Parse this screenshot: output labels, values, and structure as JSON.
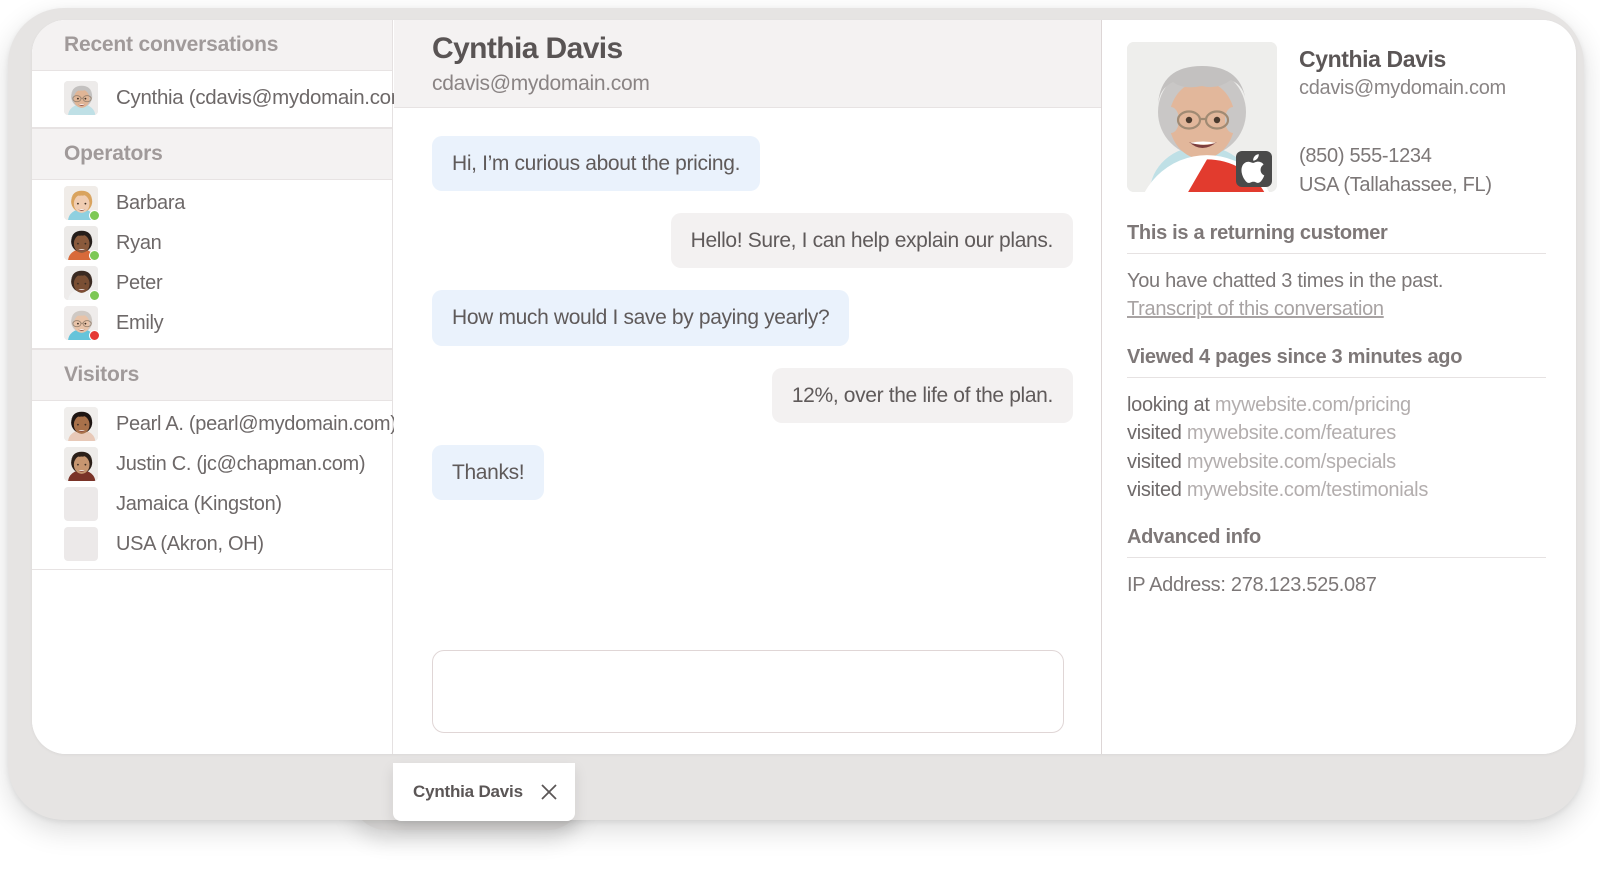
{
  "sidebar": {
    "sections": [
      {
        "title": "Recent conversations",
        "items": [
          {
            "label": "Cynthia (cdavis@mydomain.com)",
            "avatar": "cynthia",
            "status": ""
          }
        ]
      },
      {
        "title": "Operators",
        "items": [
          {
            "label": "Barbara",
            "avatar": "barbara",
            "status": "online",
            "status_color": "#7dc855"
          },
          {
            "label": "Ryan",
            "avatar": "ryan",
            "status": "online",
            "status_color": "#7dc855"
          },
          {
            "label": "Peter",
            "avatar": "peter",
            "status": "online",
            "status_color": "#7dc855"
          },
          {
            "label": "Emily",
            "avatar": "emily",
            "status": "busy",
            "status_color": "#e53935"
          }
        ]
      },
      {
        "title": "Visitors",
        "items": [
          {
            "label": "Pearl A. (pearl@mydomain.com)",
            "avatar": "pearl",
            "status": ""
          },
          {
            "label": "Justin C. (jc@chapman.com)",
            "avatar": "justin",
            "status": ""
          },
          {
            "label": "Jamaica (Kingston)",
            "avatar": "none",
            "status": ""
          },
          {
            "label": "USA (Akron, OH)",
            "avatar": "none",
            "status": ""
          }
        ]
      }
    ]
  },
  "chat": {
    "title": "Cynthia Davis",
    "subtitle": "cdavis@mydomain.com",
    "messages": [
      {
        "from": "visitor",
        "text": "Hi, I’m curious about the pricing."
      },
      {
        "from": "operator",
        "text": "Hello! Sure, I can help explain our plans."
      },
      {
        "from": "visitor",
        "text": "How much would I save by paying yearly?"
      },
      {
        "from": "operator",
        "text": "12%, over the life of the plan."
      },
      {
        "from": "visitor",
        "text": "Thanks!"
      }
    ],
    "composer_placeholder": ""
  },
  "info": {
    "name": "Cynthia Davis",
    "email": "cdavis@mydomain.com",
    "phone": "(850) 555-1234",
    "location": "USA (Tallahassee, FL)",
    "browser_icon": "chrome-icon",
    "os_icon": "apple-icon",
    "returning": {
      "title": "This is a returning customer",
      "body": "You have chatted 3 times in the past.",
      "link": "Transcript of this conversation"
    },
    "pages": {
      "title": "Viewed 4 pages since 3 minutes ago",
      "rows": [
        {
          "verb": "looking at",
          "url": "mywebsite.com/pricing"
        },
        {
          "verb": "visited",
          "url": "mywebsite.com/features"
        },
        {
          "verb": "visited",
          "url": "mywebsite.com/specials"
        },
        {
          "verb": "visited",
          "url": "mywebsite.com/testimonials"
        }
      ]
    },
    "advanced": {
      "title": "Advanced info",
      "ip": "IP Address: 278.123.525.087"
    }
  },
  "bottom_tab": {
    "title": "Cynthia Davis",
    "close_icon": "close-icon"
  },
  "colors": {
    "bubble_visitor": "#eaf2fc",
    "bubble_operator": "#f3f1f1",
    "status_online": "#7dc855",
    "status_busy": "#e53935",
    "panel_header": "#f4f2f2"
  }
}
